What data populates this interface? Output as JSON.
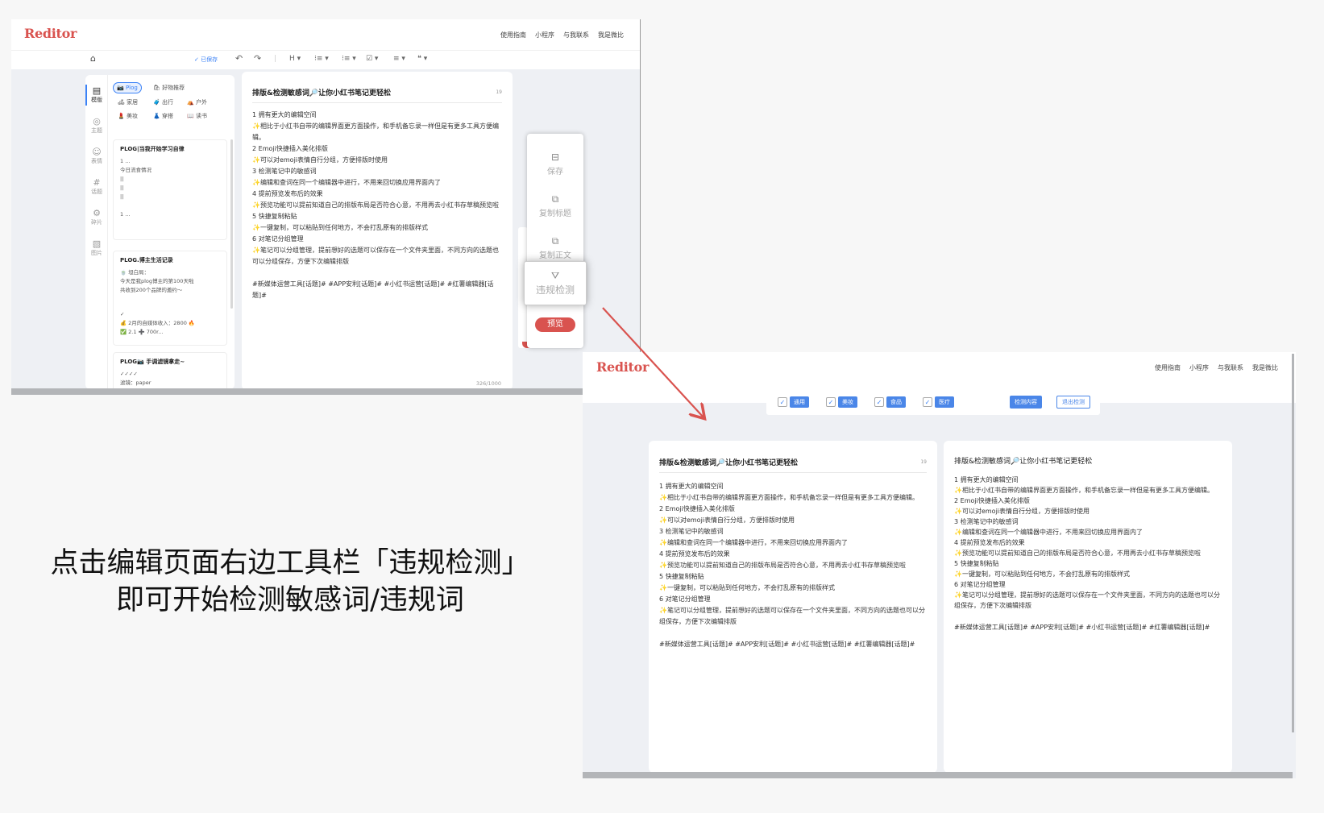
{
  "app": {
    "logo": "Reditor",
    "nav": [
      "使用指南",
      "小程序",
      "与我联系",
      "我是微比"
    ]
  },
  "editor_toolbar": {
    "saved": "✓ 已保存",
    "undo": "↶",
    "redo": "↷",
    "heading": "H ▾",
    "ordered_list": "⁝≡ ▾",
    "bullet_list": "⁝≡ ▾",
    "checklist": "☑ ▾",
    "align": "≡ ▾",
    "quote": "❝ ▾"
  },
  "sidebar": {
    "items": [
      {
        "icon": "template-icon",
        "label": "模版",
        "active": true
      },
      {
        "icon": "theme-icon",
        "label": "主题"
      },
      {
        "icon": "emoji-icon",
        "label": "表情"
      },
      {
        "icon": "topic-icon",
        "label": "话题"
      },
      {
        "icon": "card-icon",
        "label": "碎片"
      },
      {
        "icon": "image-icon",
        "label": "图片"
      }
    ]
  },
  "categories": [
    {
      "label": "📷 Plog",
      "selected": true
    },
    {
      "label": "🛍 好物推荐"
    },
    {
      "label": "🛋 家居"
    },
    {
      "label": "🧳 出行"
    },
    {
      "label": "⛺ 户外"
    },
    {
      "label": "💄 美妆"
    },
    {
      "label": "👗 穿搭"
    },
    {
      "label": "📖 读书"
    }
  ],
  "template_cards": [
    {
      "title": "PLOG|当我开始学习自律",
      "lines": [
        "1 ...",
        "今日流食情况",
        "||",
        "||",
        "||",
        "",
        "1 ..."
      ]
    },
    {
      "title": "PLOG.博主生活记录",
      "lines": [
        "🍵 坦白局：",
        "今天是我plog博主的第100天啦",
        "共收到200个品牌的邀约～",
        "",
        "",
        "✓",
        "💰 2月的自媒体收入：2800 🔥",
        "✅ 2.1 ➕ 700r..."
      ]
    },
    {
      "title": "PLOG📷 手调滤镜拿走~",
      "lines": [
        "✓✓✓✓",
        "滤镜：paper"
      ]
    }
  ],
  "editor": {
    "title": "排版&检测敏感词🔎让你小红书笔记更轻松",
    "title_count": "19",
    "lines": [
      "1 拥有更大的编辑空间",
      "✨相比于小红书自带的编辑界面更方面操作，和手机备忘录一样但是有更多工具方便编辑。",
      "2 Emoji快捷插入美化排版",
      "✨可以对emoji表情自行分组，方便排版时使用",
      "3 检测笔记中的敏感词",
      "✨编辑和查词在同一个编辑器中进行，不用来回切换应用界面内了",
      "4 提前预览发布后的效果",
      "✨预览功能可以提前知道自己的排版布局是否符合心意，不用再去小红书存草稿预览啦",
      "5 快捷复制粘贴",
      "✨一键复制，可以粘贴到任何地方，不会打乱原有的排版样式",
      "6 对笔记分组管理",
      "✨笔记可以分组管理，提前想好的选题可以保存在一个文件夹里面，不同方向的选题也可以分组保存，方便下次编辑排版"
    ],
    "tags": "#新媒体运营工具[话题]# #APP安利[话题]# #小红书运营[话题]# #红薯编辑器[话题]#",
    "char_count": "326/1000"
  },
  "float_toolbar": {
    "save": "保存",
    "copy_title": "复制标题",
    "copy_body": "复制正文",
    "violation_check": "违规检测",
    "preview": "预览"
  },
  "check_page": {
    "filters": [
      "通用",
      "美妆",
      "食品",
      "医疗"
    ],
    "detect_button": "检测内容",
    "exit_button": "退出检测"
  },
  "caption": {
    "line1": "点击编辑页面右边工具栏「违规检测」",
    "line2": "即可开始检测敏感词/违规词"
  },
  "colors": {
    "brand_red": "#d9534f",
    "accent_blue": "#4a86e8",
    "arrow_red": "#d9534f"
  }
}
